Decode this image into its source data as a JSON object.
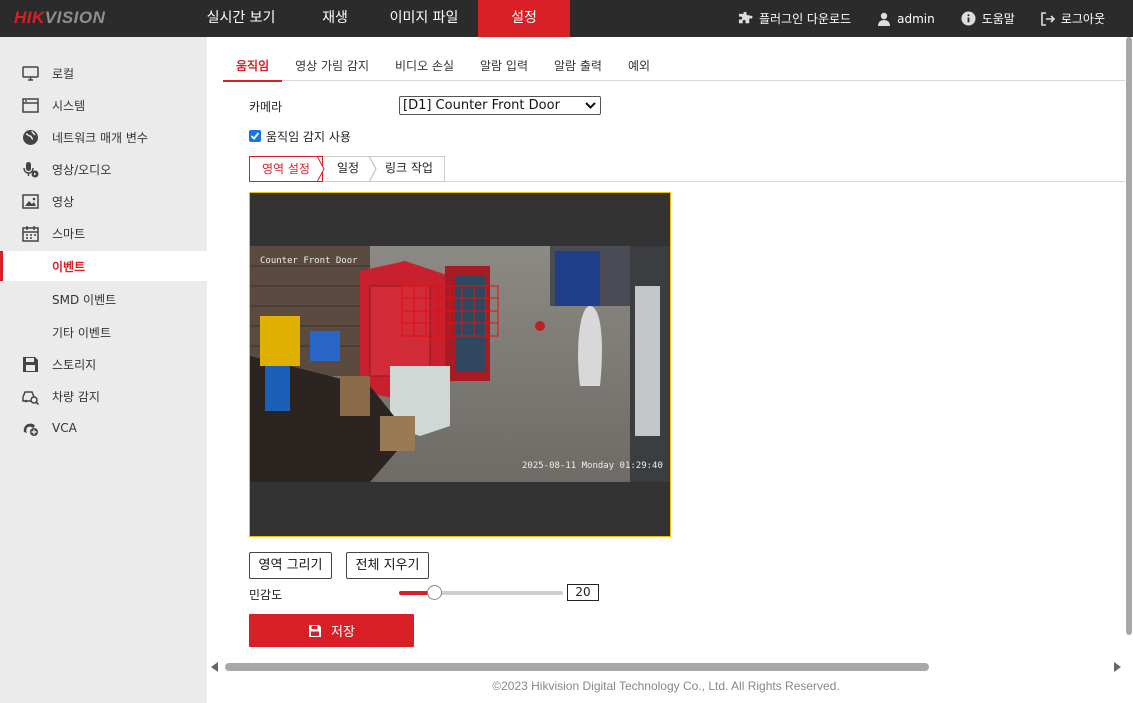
{
  "header": {
    "logo_red": "HIK",
    "logo_gray": "VISION",
    "nav": [
      {
        "label": "실시간 보기"
      },
      {
        "label": "재생"
      },
      {
        "label": "이미지 파일"
      },
      {
        "label": "설정"
      }
    ],
    "right": {
      "plugin": "플러그인 다운로드",
      "user": "admin",
      "help": "도움말",
      "logout": "로그아웃"
    }
  },
  "sidebar": {
    "items": [
      {
        "label": "로컬",
        "icon": "monitor-icon"
      },
      {
        "label": "시스템",
        "icon": "system-icon"
      },
      {
        "label": "네트워크 매개 변수",
        "icon": "globe-icon"
      },
      {
        "label": "영상/오디오",
        "icon": "mic-icon"
      },
      {
        "label": "영상",
        "icon": "image-icon"
      },
      {
        "label": "스마트",
        "icon": "calendar-icon"
      },
      {
        "label": "이벤트"
      },
      {
        "label": "SMD 이벤트"
      },
      {
        "label": "기타 이벤트"
      },
      {
        "label": "스토리지",
        "icon": "save-icon"
      },
      {
        "label": "차량 감지",
        "icon": "vehicle-search-icon"
      },
      {
        "label": "VCA",
        "icon": "vca-icon"
      }
    ]
  },
  "tabs": [
    {
      "label": "움직임"
    },
    {
      "label": "영상 가림 감지"
    },
    {
      "label": "비디오 손실"
    },
    {
      "label": "알람 입력"
    },
    {
      "label": "알람 출력"
    },
    {
      "label": "예외"
    }
  ],
  "camera": {
    "label": "카메라",
    "selected": "[D1] Counter Front Door"
  },
  "enable": {
    "label": "움직임 감지 사용",
    "checked": true
  },
  "subtabs": [
    {
      "label": "영역 설정"
    },
    {
      "label": "일정"
    },
    {
      "label": "링크 작업"
    }
  ],
  "video": {
    "osd_name": "Counter Front Door",
    "osd_time": "2025-08-11 Monday 01:29:40"
  },
  "buttons": {
    "draw": "영역 그리기",
    "clear": "전체 지우기",
    "save": "저장"
  },
  "sensitivity": {
    "label": "민감도",
    "value": "20",
    "fraction": 0.22
  },
  "footer": "©2023 Hikvision Digital Technology Co., Ltd. All Rights Reserved.",
  "colors": {
    "accent": "#d91f26",
    "topbar": "#2b2b2b",
    "sidebar": "#ebebeb"
  }
}
